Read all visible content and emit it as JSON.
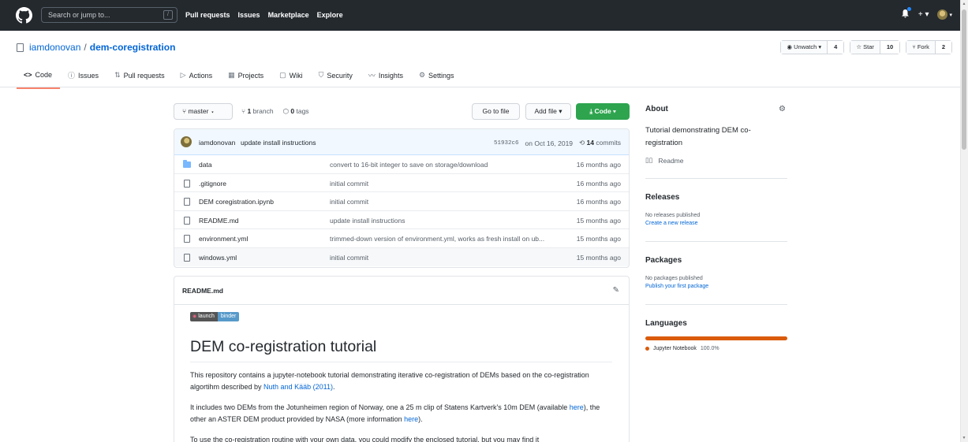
{
  "header": {
    "search_placeholder": "Search or jump to...",
    "slash_key": "/",
    "nav": [
      "Pull requests",
      "Issues",
      "Marketplace",
      "Explore"
    ],
    "plus": "+ ▾",
    "avatar_caret": "▾"
  },
  "repo": {
    "owner": "iamdonovan",
    "separator": "/",
    "name": "dem-coregistration",
    "watch_label": "Unwatch ▾",
    "watch_count": "4",
    "star_label": "Star",
    "star_count": "10",
    "fork_label": "Fork",
    "fork_count": "2"
  },
  "tabs": [
    {
      "icon": "<>",
      "label": "Code"
    },
    {
      "icon": "ⓘ",
      "label": "Issues"
    },
    {
      "icon": "⇅",
      "label": "Pull requests"
    },
    {
      "icon": "▷",
      "label": "Actions"
    },
    {
      "icon": "▦",
      "label": "Projects"
    },
    {
      "icon": "▢",
      "label": "Wiki"
    },
    {
      "icon": "⛉",
      "label": "Security"
    },
    {
      "icon": "〰",
      "label": "Insights"
    },
    {
      "icon": "⚙",
      "label": "Settings"
    }
  ],
  "branch": {
    "current": "master",
    "branches_count": "1",
    "branches_label": "branch",
    "tags_count": "0",
    "tags_label": "tags",
    "goto_file": "Go to file",
    "add_file": "Add file ▾",
    "code": "Code ▾"
  },
  "commit": {
    "user": "iamdonovan",
    "message": "update install instructions",
    "sha": "51932c6",
    "date": "on Oct 16, 2019",
    "commits_count": "14",
    "commits_label": "commits"
  },
  "files": [
    {
      "type": "folder",
      "name": "data",
      "message": "convert to 16-bit integer to save on storage/download",
      "age": "16 months ago"
    },
    {
      "type": "file",
      "name": ".gitignore",
      "message": "initial commit",
      "age": "16 months ago"
    },
    {
      "type": "file",
      "name": "DEM coregistration.ipynb",
      "message": "initial commit",
      "age": "16 months ago"
    },
    {
      "type": "file",
      "name": "README.md",
      "message": "update install instructions",
      "age": "15 months ago"
    },
    {
      "type": "file",
      "name": "environment.yml",
      "message": "trimmed-down version of environment.yml, works as fresh install on ub...",
      "age": "15 months ago"
    },
    {
      "type": "file",
      "name": "windows.yml",
      "message": "initial commit",
      "age": "15 months ago"
    }
  ],
  "readme": {
    "filename": "README.md",
    "badge_left": "launch",
    "badge_right": "binder",
    "title": "DEM co-registration tutorial",
    "p1_a": "This repository contains a jupyter-notebook tutorial demonstrating iterative co-registration of DEMs based on the co-registration algortihm described by ",
    "p1_link": "Nuth and Kääb (2011)",
    "p1_b": ".",
    "p2_a": "It includes two DEMs from the Jotunheimen region of Norway, one a 25 m clip of Statens Kartverk's 10m DEM (available ",
    "p2_link1": "here",
    "p2_b": "), the other an ASTER DEM product provided by NASA (more information ",
    "p2_link2": "here",
    "p2_c": ").",
    "p3": "To use the co-registration routine with your own data, you could modify the enclosed tutorial, but you may find it"
  },
  "sidebar": {
    "about_title": "About",
    "about_desc": "Tutorial demonstrating DEM co-registration",
    "readme_link": "Readme",
    "releases_title": "Releases",
    "releases_none": "No releases published",
    "releases_create": "Create a new release",
    "packages_title": "Packages",
    "packages_none": "No packages published",
    "packages_publish": "Publish your first package",
    "languages_title": "Languages",
    "language_name": "Jupyter Notebook",
    "language_pct": "100.0%",
    "language_share": 1.0,
    "language_color": "#da5b0b"
  }
}
